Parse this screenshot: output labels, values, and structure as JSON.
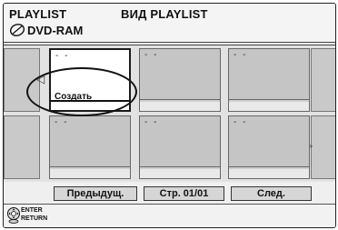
{
  "header": {
    "mode": "PLAYLIST",
    "title": "ВИД PLAYLIST",
    "disc": "DVD-RAM"
  },
  "thumbnails": [
    {
      "label": "Создать",
      "dash": "- -",
      "selected": true
    },
    {
      "label": "",
      "dash": "- -",
      "selected": false
    },
    {
      "label": "",
      "dash": "- -",
      "selected": false
    },
    {
      "label": "",
      "dash": "- -",
      "selected": false
    },
    {
      "label": "",
      "dash": "- -",
      "selected": false
    },
    {
      "label": "",
      "dash": "- -",
      "selected": false
    }
  ],
  "navigation": {
    "prev": "Предыдущ.",
    "page": "Стр. 01/01",
    "next": "След."
  },
  "legend": {
    "enter": "ENTER",
    "return": "RETURN"
  },
  "icons": {
    "left_arrow": "left-arrow-icon",
    "right_arrow": "right-arrow-icon",
    "disc": "dvd-ram-disc-icon",
    "remote": "remote-navigation-icon"
  }
}
